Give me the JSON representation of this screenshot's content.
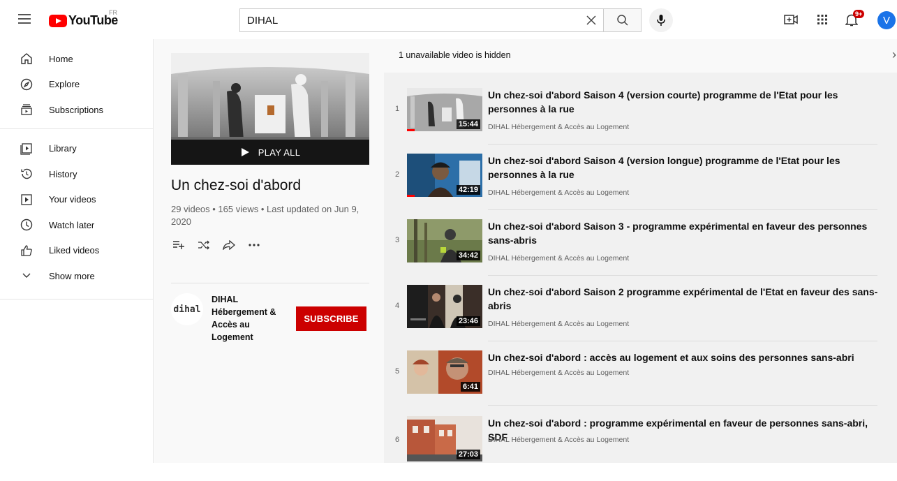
{
  "header": {
    "logo_text": "YouTube",
    "country": "FR",
    "search_value": "DIHAL",
    "notification_count": "9+",
    "avatar_letter": "V"
  },
  "sidebar": {
    "items": [
      {
        "label": "Home",
        "icon": "home-icon"
      },
      {
        "label": "Explore",
        "icon": "compass-icon"
      },
      {
        "label": "Subscriptions",
        "icon": "subscriptions-icon"
      },
      {
        "label": "Library",
        "icon": "library-icon"
      },
      {
        "label": "History",
        "icon": "history-icon"
      },
      {
        "label": "Your videos",
        "icon": "your-videos-icon"
      },
      {
        "label": "Watch later",
        "icon": "clock-icon"
      },
      {
        "label": "Liked videos",
        "icon": "thumbs-up-icon"
      },
      {
        "label": "Show more",
        "icon": "chevron-down-icon"
      }
    ]
  },
  "playlist": {
    "play_all": "PLAY ALL",
    "title": "Un chez-soi d'abord",
    "stats": "29 videos • 165 views • Last updated on Jun 9, 2020",
    "owner_avatar_text": "dihal",
    "owner_name": "DIHAL Hébergement & Accès au Logement",
    "subscribe_label": "SUBSCRIBE"
  },
  "list": {
    "unavailable_notice": "1 unavailable video is hidden",
    "videos": [
      {
        "index": "1",
        "title": "Un chez-soi d'abord Saison 4 (version courte) programme de l'Etat pour les personnes à la rue",
        "channel": "DIHAL Hébergement & Accès au Logement",
        "duration": "15:44",
        "progress": 0.1
      },
      {
        "index": "2",
        "title": "Un chez-soi d'abord Saison 4 (version longue) programme de l'Etat pour les personnes à la rue",
        "channel": "DIHAL Hébergement & Accès au Logement",
        "duration": "42:19",
        "progress": 0.1
      },
      {
        "index": "3",
        "title": "Un chez-soi d'abord Saison 3 - programme expérimental en faveur des personnes sans-abris",
        "channel": "DIHAL Hébergement & Accès au Logement",
        "duration": "34:42",
        "progress": 0
      },
      {
        "index": "4",
        "title": "Un chez-soi d'abord Saison 2 programme expérimental de l'Etat en faveur des sans-abris",
        "channel": "DIHAL Hébergement & Accès au Logement",
        "duration": "23:46",
        "progress": 0
      },
      {
        "index": "5",
        "title": "Un chez-soi d'abord : accès au logement et aux soins des personnes sans-abri",
        "channel": "DIHAL Hébergement & Accès au Logement",
        "duration": "6:41",
        "progress": 0
      },
      {
        "index": "6",
        "title": "Un chez-soi d'abord : programme expérimental en faveur de personnes sans-abri, SDF",
        "channel": "DIHAL Hébergement & Accès au Logement",
        "duration": "27:03",
        "progress": 0
      }
    ]
  }
}
